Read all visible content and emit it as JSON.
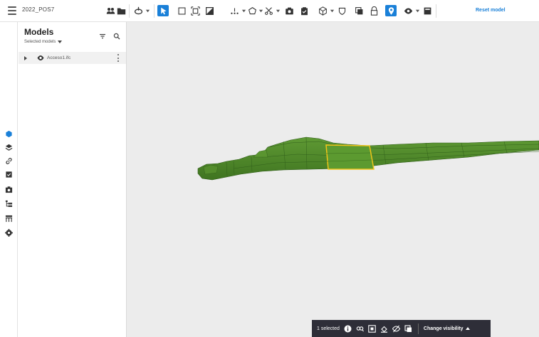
{
  "header": {
    "project_name": "2022_POS7",
    "reset_label": "Reset model"
  },
  "toolbar": {
    "icons": [
      "users-icon",
      "folder-icon",
      "orbit-icon",
      "select-icon",
      "box-select-icon",
      "fit-icon",
      "section-box-icon",
      "measure-icon",
      "shape-icon",
      "cut-icon",
      "snapshot-icon",
      "clipboard-icon",
      "cube-icon",
      "shield-icon",
      "copy-icon",
      "lock-icon",
      "properties-icon",
      "eye-icon",
      "save-icon"
    ],
    "active": [
      "select-icon",
      "properties-icon"
    ],
    "accent_color": "#1a80d8"
  },
  "rail": {
    "icons": [
      "models-icon",
      "layers-icon",
      "link-icon",
      "checklist-icon",
      "camera-icon",
      "tree-icon",
      "table-icon",
      "settings-icon"
    ]
  },
  "panel": {
    "title": "Models",
    "subtitle": "Selected models",
    "models": [
      {
        "name": "Acceso1.ifc",
        "visible": true
      }
    ]
  },
  "viewport": {
    "model_color": "#4f8a2a",
    "highlight_color": "#f0c419"
  },
  "selection_bar": {
    "count_label": "1 selected",
    "visibility_label": "Change visibility"
  }
}
